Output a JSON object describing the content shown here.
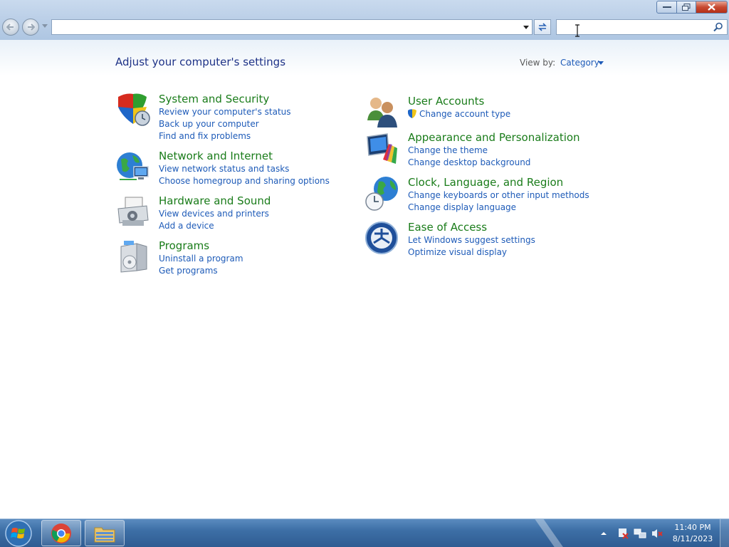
{
  "window": {
    "minimize_icon": "minimize-icon",
    "maximize_icon": "restore-icon",
    "close_icon": "close-icon"
  },
  "toolbar": {
    "address_value": "",
    "search_placeholder": "",
    "search_value": ""
  },
  "page": {
    "title": "Adjust your computer's settings",
    "view_by_label": "View by:",
    "view_by_value": "Category"
  },
  "categories_left": [
    {
      "title": "System and Security",
      "icon": "shield-icon",
      "links": [
        "Review your computer's status",
        "Back up your computer",
        "Find and fix problems"
      ]
    },
    {
      "title": "Network and Internet",
      "icon": "network-globe-icon",
      "links": [
        "View network status and tasks",
        "Choose homegroup and sharing options"
      ]
    },
    {
      "title": "Hardware and Sound",
      "icon": "printer-icon",
      "links": [
        "View devices and printers",
        "Add a device"
      ]
    },
    {
      "title": "Programs",
      "icon": "programs-box-icon",
      "links": [
        "Uninstall a program",
        "Get programs"
      ]
    }
  ],
  "categories_right": [
    {
      "title": "User Accounts",
      "icon": "users-icon",
      "links": [
        "Change account type"
      ]
    },
    {
      "title": "Appearance and Personalization",
      "icon": "monitor-palette-icon",
      "links": [
        "Change the theme",
        "Change desktop background"
      ]
    },
    {
      "title": "Clock, Language, and Region",
      "icon": "globe-clock-icon",
      "links": [
        "Change keyboards or other input methods",
        "Change display language"
      ]
    },
    {
      "title": "Ease of Access",
      "icon": "ease-of-access-icon",
      "links": [
        "Let Windows suggest settings",
        "Optimize visual display"
      ]
    }
  ],
  "taskbar": {
    "time": "11:40 PM",
    "date": "8/11/2023",
    "pinned": [
      "chrome-icon",
      "file-explorer-icon"
    ]
  },
  "colors": {
    "category_title": "#1a7c1a",
    "link": "#1e5bb8",
    "page_title": "#1e3287"
  }
}
